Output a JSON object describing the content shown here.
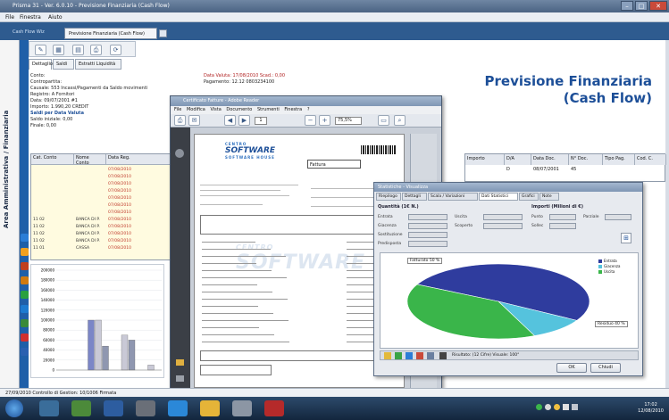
{
  "window": {
    "title": "Prisma 31 - Ver. 6.0.10 - Previsione Finanziaria (Cash Flow)",
    "menu": [
      "File",
      "Finestra",
      "Aiuto"
    ]
  },
  "app_tabs": {
    "left": "Cash Flow Wiz",
    "active": "Previsione Finanziaria (Cash Flow)"
  },
  "sidebar": {
    "label": "Area Amministrativa / Finanziaria"
  },
  "subtabs": [
    "Dettaglio",
    "Saldi",
    "Estratti Liquidità"
  ],
  "info": {
    "lines": [
      "Conto:",
      "Contropartita:",
      "Causale:  553 Incassi/Pagamenti da Saldo movimenti",
      "Registro:  A  Fornitori",
      "Data:  09/07/2001   #1",
      "Importo:   1.990,20 CREDIT",
      "Saldi per Data Valuta",
      "Saldo iniziale:           0,00",
      "Finale:                    0,00"
    ],
    "red_lines": [
      "Data Valuta: 17/08/2010        Scad.:     0,00",
      "Pagamento:  12.12     0803234100"
    ]
  },
  "heading": {
    "line1": "Previsione Finanziaria",
    "line2": "(Cash Flow)"
  },
  "grid": {
    "headers": [
      "Cat. Conto",
      "Nome Conto",
      "Data Reg."
    ],
    "rows": [
      [
        "",
        "",
        "07/08/2010"
      ],
      [
        "",
        "",
        "07/08/2010"
      ],
      [
        "",
        "",
        "07/08/2010"
      ],
      [
        "",
        "",
        "07/08/2010"
      ],
      [
        "",
        "",
        "07/08/2010"
      ],
      [
        "",
        "",
        "07/08/2010"
      ],
      [
        "",
        "",
        "07/08/2010"
      ],
      [
        "11 02",
        "BANCA DI P.",
        "07/08/2010"
      ],
      [
        "11 02",
        "BANCA DI P.",
        "07/08/2010"
      ],
      [
        "11 02",
        "BANCA DI P.",
        "07/08/2010"
      ],
      [
        "11 02",
        "BANCA DI P.",
        "07/08/2010"
      ],
      [
        "11 01",
        "CASSA",
        "07/08/2010"
      ]
    ]
  },
  "grid2": {
    "headers": [
      "Importo",
      "D/A",
      "Data Doc.",
      "N° Doc.",
      "Tipo Pag.",
      "Cod. C."
    ],
    "row": [
      "",
      "D",
      "08/07/2001",
      "45",
      "",
      ""
    ]
  },
  "bar_chart": {
    "y_ticks": [
      "200000",
      "180000",
      "160000",
      "140000",
      "120000",
      "100000",
      "80000",
      "60000",
      "40000",
      "20000",
      "0"
    ],
    "groups": [
      {
        "values": [
          0,
          0,
          0
        ]
      },
      {
        "values": [
          100000,
          100000,
          48000
        ]
      },
      {
        "values": [
          0,
          70000,
          60000
        ]
      },
      {
        "values": [
          0,
          10000,
          0
        ]
      }
    ],
    "colors": [
      "#7b86c7",
      "#c9c9d6",
      "#8f97b0"
    ]
  },
  "pdf": {
    "title": "Certificato Fatture - Adobe Reader",
    "menu": [
      "File",
      "Modifica",
      "Vista",
      "Documento",
      "Strumenti",
      "Finestra",
      "?"
    ],
    "zoom": "75,5%",
    "page_nav": "1",
    "logo_top": "CENTRO",
    "logo_main": "SOFTWARE",
    "logo_sub": "SOFTWARE HOUSE",
    "watermark_top": "CENTRO",
    "watermark": "SOFTWARE",
    "doc_type": "Fattura"
  },
  "stat": {
    "title": "Statistiche - Visualizza",
    "tabs": [
      "Riepilogo",
      "Dettagli",
      "Scala / Variazioni",
      "Dati Statistici",
      "Grafici",
      "Note"
    ],
    "active_tab": "Dati Statistici",
    "section_left": "Quantità (1€ N.)",
    "section_right": "Importi (Milioni di €)",
    "fields": [
      "Entrata",
      "Uscita",
      "Giacenza",
      "Scoperto",
      "Sostituzione",
      "Predisposta",
      "Punto",
      "Parziale",
      "Sollec"
    ],
    "pie": {
      "slices": [
        {
          "label": "Fatturato",
          "value": 51,
          "color": "#2f3c9e"
        },
        {
          "label": "Incassato",
          "value": 10,
          "color": "#55c3dd"
        },
        {
          "label": "Residuo",
          "value": 39,
          "color": "#3ab54a"
        }
      ],
      "label_left": "Fatturato 50 %",
      "label_right": "Residuo 40 %"
    },
    "legend": [
      "Entrata",
      "Giacenza",
      "Uscita"
    ],
    "toolbar_text": "Risultato:  (12 Cifre)    Visuale: 100°",
    "ok": "OK",
    "close": "Chiudi"
  },
  "status": {
    "text": "27/09/2010    Controllo di Gestion: 10/1006    Firmata"
  },
  "tray": {
    "time": "17:02",
    "date": "12/08/2010"
  }
}
